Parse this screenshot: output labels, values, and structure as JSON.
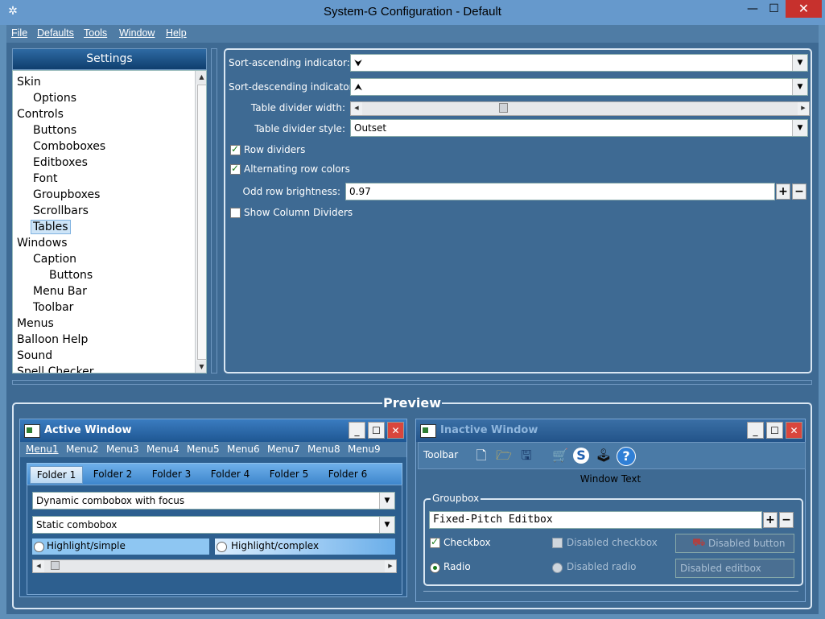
{
  "window": {
    "title": "System-G Configuration - Default",
    "app_icon": "gear-icon",
    "min": "—",
    "max": "☐",
    "close": "✕"
  },
  "menubar": {
    "items": [
      "File",
      "Defaults",
      "Tools",
      "Window",
      "Help"
    ]
  },
  "settings": {
    "header": "Settings",
    "tree": [
      "Skin",
      "Options",
      "Controls",
      "Buttons",
      "Comboboxes",
      "Editboxes",
      "Font",
      "Groupboxes",
      "Scrollbars",
      "Tables",
      "Windows",
      "Caption",
      "Buttons",
      "Menu Bar",
      "Toolbar",
      "Menus",
      "Balloon Help",
      "Sound",
      "Spell Checker"
    ],
    "selected": "Tables"
  },
  "table_settings": {
    "sort_asc_label": "Sort-ascending indicator:",
    "sort_asc_value": "⮟",
    "sort_desc_label": "Sort-descending indicator:",
    "sort_desc_value": "⮝",
    "divider_width_label": "Table divider width:",
    "divider_width_value": 0.32,
    "divider_style_label": "Table divider style:",
    "divider_style_value": "Outset",
    "row_dividers_label": "Row dividers",
    "row_dividers_checked": true,
    "alt_row_colors_label": "Alternating row colors",
    "alt_row_colors_checked": true,
    "odd_row_brightness_label": "Odd row brightness:",
    "odd_row_brightness_value": "0.97",
    "show_col_dividers_label": "Show Column Dividers",
    "show_col_dividers_checked": false,
    "plus": "+",
    "minus": "−"
  },
  "preview": {
    "title": "Preview",
    "active": {
      "title": "Active Window",
      "menus": [
        "Menu1",
        "Menu2",
        "Menu3",
        "Menu4",
        "Menu5",
        "Menu6",
        "Menu7",
        "Menu8",
        "Menu9"
      ],
      "tabs": [
        "Folder 1",
        "Folder 2",
        "Folder 3",
        "Folder 4",
        "Folder 5",
        "Folder 6"
      ],
      "combo_focus": "Dynamic combobox with focus",
      "combo_static": "Static combobox",
      "radio_simple": "Highlight/simple",
      "radio_complex": "Highlight/complex",
      "slider_value": 0.02
    },
    "inactive": {
      "title": "Inactive Window",
      "toolbar_label": "Toolbar",
      "toolbar_icons": [
        "new-document-icon",
        "open-folder-icon",
        "save-disk-icon",
        "cart-icon",
        "s-logo-icon",
        "joystick-icon",
        "help-icon"
      ],
      "window_text": "Window Text",
      "groupbox_label": "Groupbox",
      "fixed_editbox": "Fixed-Pitch Editbox",
      "checkbox_label": "Checkbox",
      "checkbox_checked": true,
      "disabled_checkbox_label": "Disabled checkbox",
      "disabled_button_label": "Disabled button",
      "radio_label": "Radio",
      "disabled_radio_label": "Disabled radio",
      "disabled_editbox": "Disabled editbox"
    }
  },
  "colors": {
    "accent": "#3e6a93",
    "title": "#6699cc",
    "close": "#c7312d"
  }
}
